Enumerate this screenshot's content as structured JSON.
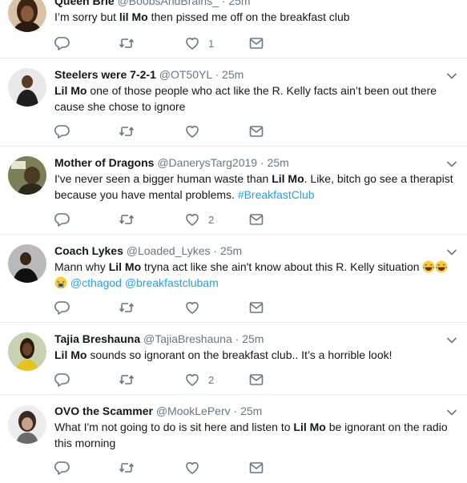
{
  "tweets": [
    {
      "name": "Queen Brie",
      "handle": "@BoobsAndBrains_",
      "time": "25m",
      "text_pre": "I’m sorry but ",
      "mention": "lil Mo",
      "text_post": " then pissed me off on the breakfast club",
      "likes": "1"
    },
    {
      "name": "Steelers were 7-2-1",
      "handle": "@OT50YL",
      "time": "25m",
      "mention": "Lil Mo",
      "text_post": " one of those people who act like the R. Kelly facts ain’t been out there",
      "text_line2": "cause she chose to ignore"
    },
    {
      "name": "Mother of Dragons",
      "handle": "@DanerysTarg2019",
      "time": "25m",
      "text_pre": "I've never seen a bigger human waste than ",
      "mention": "Lil Mo",
      "text_post": ". Like, bitch go see a therapist",
      "text_line2": "because you have mental problems. ",
      "hashtag": "#BreakfastClub",
      "likes": "2"
    },
    {
      "name": "Coach Lykes",
      "handle": "@Loaded_Lykes",
      "time": "25m",
      "text_pre": "Mann why ",
      "mention": "Lil Mo",
      "text_post": " tryna act like she ain't know about this R. Kelly situation",
      "link1": "@cthagod",
      "link2": "@breakfastclubam"
    },
    {
      "name": "Tajia Breshauna",
      "handle": "@TajiaBreshauna",
      "time": "25m",
      "mention": "Lil Mo",
      "text_post": " sounds so ignorant on the breakfast club.. It’s a horrible look!",
      "likes": "2"
    },
    {
      "name": "OVO the Scammer",
      "handle": "@MookLePerv",
      "time": "25m",
      "text_pre": "What I'm not going to do is sit here and listen to ",
      "mention": "Lil Mo",
      "text_post": " be ignorant on the radio",
      "text_line2": "this morning"
    }
  ],
  "separator": "·",
  "colors": {
    "text": "#14171a",
    "secondary": "#657786",
    "link": "#1da1f2",
    "border": "#e6ecf0"
  },
  "icons": [
    "reply-icon",
    "retweet-icon",
    "like-icon",
    "direct-message-icon",
    "chevron-down-icon"
  ]
}
